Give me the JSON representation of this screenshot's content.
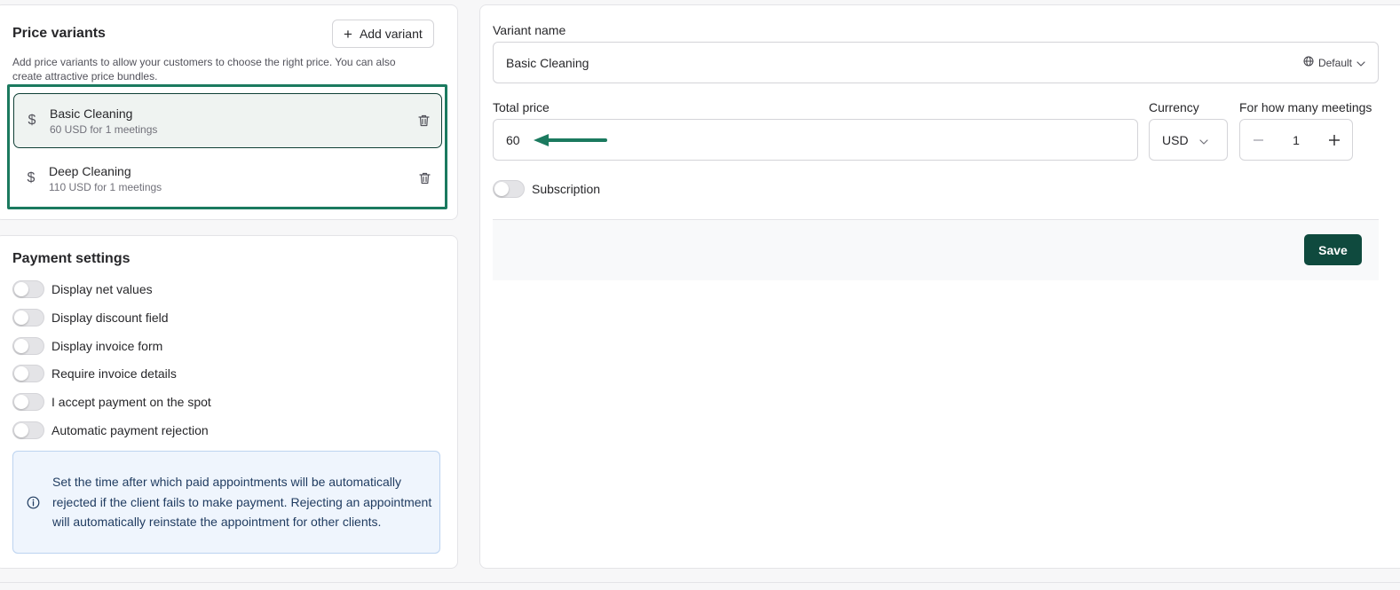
{
  "price_variants": {
    "title": "Price variants",
    "add_label": "Add variant",
    "description_line1": "Add price variants to allow your customers to choose the right price. You can also",
    "description_line2": "create attractive price bundles.",
    "items": [
      {
        "name": "Basic Cleaning",
        "summary": "60 USD for 1 meetings",
        "selected": true
      },
      {
        "name": "Deep Cleaning",
        "summary": "110 USD for 1 meetings",
        "selected": false
      }
    ]
  },
  "payment_settings": {
    "title": "Payment settings",
    "toggles": [
      {
        "label": "Display net values",
        "on": false
      },
      {
        "label": "Display discount field",
        "on": false
      },
      {
        "label": "Display invoice form",
        "on": false
      },
      {
        "label": "Require invoice details",
        "on": false
      },
      {
        "label": "I accept payment on the spot",
        "on": false
      },
      {
        "label": "Automatic payment rejection",
        "on": false
      }
    ],
    "info_text": "Set the time after which paid appointments will be automatically rejected if the client fails to make payment. Rejecting an appointment will automatically reinstate the appointment for other clients."
  },
  "variant_form": {
    "name_label": "Variant name",
    "name_value": "Basic Cleaning",
    "locale_value": "Default",
    "price_label": "Total price",
    "price_value": "60",
    "currency_label": "Currency",
    "currency_value": "USD",
    "meetings_label": "For how many meetings",
    "meetings_value": "1",
    "subscription_label": "Subscription",
    "subscription_on": false,
    "save_label": "Save"
  },
  "colors": {
    "accent": "#0f4a3e",
    "highlight_border": "#1b7a5f",
    "arrow": "#1b7a5f",
    "info_bg": "#eff5fd"
  },
  "icons": {
    "add": "plus-icon",
    "variant": "dollar-icon",
    "delete": "trash-icon",
    "locale": "globe-icon",
    "dropdown": "chevron-down-icon",
    "info": "info-icon",
    "annotation": "arrow-left-icon"
  }
}
